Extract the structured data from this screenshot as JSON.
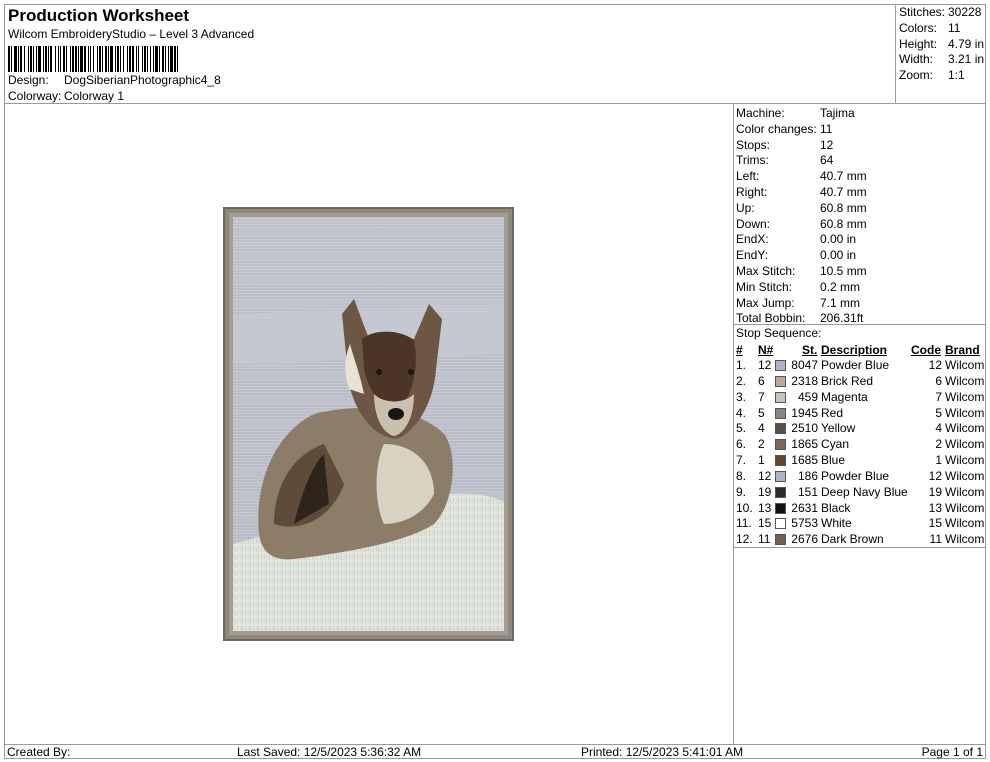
{
  "header": {
    "title": "Production Worksheet",
    "subtitle": "Wilcom EmbroideryStudio – Level 3 Advanced",
    "design_label": "Design:",
    "design_value": "DogSiberianPhotographic4_8",
    "colorway_label": "Colorway:",
    "colorway_value": "Colorway 1"
  },
  "stats": {
    "stitches_label": "Stitches:",
    "stitches_value": "30228",
    "colors_label": "Colors:",
    "colors_value": "11",
    "height_label": "Height:",
    "height_value": "4.79 in",
    "width_label": "Width:",
    "width_value": "3.21 in",
    "zoom_label": "Zoom:",
    "zoom_value": "1:1"
  },
  "info": [
    {
      "label": "Machine:",
      "value": "Tajima"
    },
    {
      "label": "Color changes:",
      "value": "11"
    },
    {
      "label": "Stops:",
      "value": "12"
    },
    {
      "label": "Trims:",
      "value": "64"
    },
    {
      "label": "Left:",
      "value": "40.7 mm"
    },
    {
      "label": "Right:",
      "value": "40.7 mm"
    },
    {
      "label": "Up:",
      "value": "60.8 mm"
    },
    {
      "label": "Down:",
      "value": "60.8 mm"
    },
    {
      "label": "EndX:",
      "value": "0.00 in"
    },
    {
      "label": "EndY:",
      "value": "0.00 in"
    },
    {
      "label": "Max Stitch:",
      "value": "10.5 mm"
    },
    {
      "label": "Min Stitch:",
      "value": "0.2 mm"
    },
    {
      "label": "Max Jump:",
      "value": "7.1 mm"
    },
    {
      "label": "Total Bobbin:",
      "value": "206.31ft"
    }
  ],
  "sequence": {
    "title": "Stop Sequence:",
    "columns": {
      "num": "#",
      "n": "N#",
      "st": "St.",
      "desc": "Description",
      "code": "Code",
      "brand": "Brand"
    },
    "rows": [
      {
        "num": "1.",
        "n": "12",
        "st": "8047",
        "desc": "Powder Blue",
        "code": "12",
        "brand": "Wilcom",
        "color": "#b0b0cc"
      },
      {
        "num": "2.",
        "n": "6",
        "st": "2318",
        "desc": "Brick Red",
        "code": "6",
        "brand": "Wilcom",
        "color": "#b8a898"
      },
      {
        "num": "3.",
        "n": "7",
        "st": "459",
        "desc": "Magenta",
        "code": "7",
        "brand": "Wilcom",
        "color": "#c8c4c0"
      },
      {
        "num": "4.",
        "n": "5",
        "st": "1945",
        "desc": "Red",
        "code": "5",
        "brand": "Wilcom",
        "color": "#8a8580"
      },
      {
        "num": "5.",
        "n": "4",
        "st": "2510",
        "desc": "Yellow",
        "code": "4",
        "brand": "Wilcom",
        "color": "#585048"
      },
      {
        "num": "6.",
        "n": "2",
        "st": "1865",
        "desc": "Cyan",
        "code": "2",
        "brand": "Wilcom",
        "color": "#7a6c58"
      },
      {
        "num": "7.",
        "n": "1",
        "st": "1685",
        "desc": "Blue",
        "code": "1",
        "brand": "Wilcom",
        "color": "#6a4226"
      },
      {
        "num": "8.",
        "n": "12",
        "st": "186",
        "desc": "Powder Blue",
        "code": "12",
        "brand": "Wilcom",
        "color": "#b0b0cc"
      },
      {
        "num": "9.",
        "n": "19",
        "st": "151",
        "desc": "Deep Navy Blue",
        "code": "19",
        "brand": "Wilcom",
        "color": "#2a2a30"
      },
      {
        "num": "10.",
        "n": "13",
        "st": "2631",
        "desc": "Black",
        "code": "13",
        "brand": "Wilcom",
        "color": "#101010"
      },
      {
        "num": "11.",
        "n": "15",
        "st": "5753",
        "desc": "White",
        "code": "15",
        "brand": "Wilcom",
        "color": "#ffffff"
      },
      {
        "num": "12.",
        "n": "11",
        "st": "2676",
        "desc": "Dark Brown",
        "code": "11",
        "brand": "Wilcom",
        "color": "#6e6258"
      }
    ]
  },
  "footer": {
    "created_label": "Created By:",
    "last_saved": "Last Saved: 12/5/2023 5:36:32 AM",
    "printed": "Printed: 12/5/2023 5:41:01 AM",
    "page": "Page 1 of 1"
  }
}
